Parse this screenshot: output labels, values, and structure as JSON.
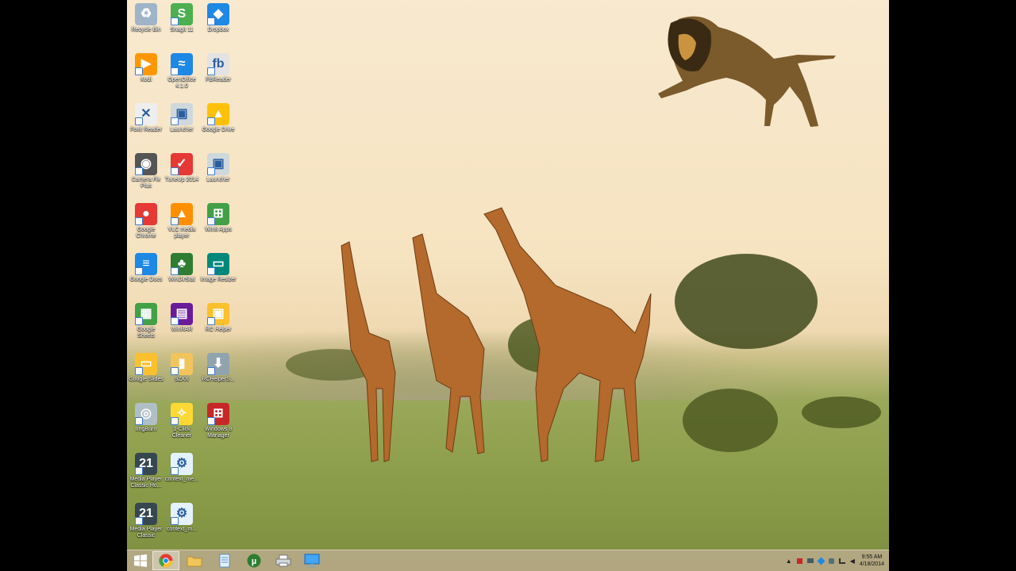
{
  "desktop": {
    "icons": [
      {
        "label": "Recycle Bin",
        "icon": "recycle-bin-icon",
        "color": "#9fb4c8"
      },
      {
        "label": "Snagit 11",
        "icon": "snagit-icon",
        "color": "#4caf50"
      },
      {
        "label": "Dropbox",
        "icon": "dropbox-icon",
        "color": "#1e88e5"
      },
      {
        "label": "Kodi",
        "icon": "media-play-icon",
        "color": "#ff9800"
      },
      {
        "label": "OpenOffice 4.1.0",
        "icon": "openoffice-icon",
        "color": "#1e88e5"
      },
      {
        "label": "FBReader",
        "icon": "fb-reader-icon",
        "color": "#e3e3e3"
      },
      {
        "label": "Foxit Reader",
        "icon": "foxit-icon",
        "color": "#eeeeee"
      },
      {
        "label": "Launcher",
        "icon": "window-icon",
        "color": "#cfd8dc"
      },
      {
        "label": "Google Drive",
        "icon": "google-drive-icon",
        "color": "#ffc107"
      },
      {
        "label": "Camera Fix Plus",
        "icon": "camera-icon",
        "color": "#555555"
      },
      {
        "label": "TuneUp 2014",
        "icon": "checkmark-icon",
        "color": "#e53935"
      },
      {
        "label": "Launcher",
        "icon": "window-icon",
        "color": "#cfd8dc"
      },
      {
        "label": "Google Chrome",
        "icon": "chrome-icon",
        "color": "#e53935"
      },
      {
        "label": "VLC media player",
        "icon": "vlc-cone-icon",
        "color": "#ff8f00"
      },
      {
        "label": "Win8 Apps",
        "icon": "windows-store-icon",
        "color": "#43a047"
      },
      {
        "label": "Google Docs",
        "icon": "google-docs-icon",
        "color": "#1e88e5"
      },
      {
        "label": "WinDirStat",
        "icon": "tree-icon",
        "color": "#2e7d32"
      },
      {
        "label": "Image Resizer",
        "icon": "picture-icon",
        "color": "#00897b"
      },
      {
        "label": "Google Sheets",
        "icon": "google-sheets-icon",
        "color": "#43a047"
      },
      {
        "label": "WinRAR",
        "icon": "winrar-icon",
        "color": "#6a1b9a"
      },
      {
        "label": "RC Helper",
        "icon": "rc-helper-icon",
        "color": "#fbc02d"
      },
      {
        "label": "Google Slides",
        "icon": "google-slides-icon",
        "color": "#fbc02d"
      },
      {
        "label": "9ZXX",
        "icon": "folder-icon",
        "color": "#f2c55c"
      },
      {
        "label": "RCHelperS...",
        "icon": "installer-icon",
        "color": "#90a4ae"
      },
      {
        "label": "ImgBurn",
        "icon": "disc-icon",
        "color": "#b0bec5"
      },
      {
        "label": "1-Click Cleaner",
        "icon": "cleaner-icon",
        "color": "#fdd835"
      },
      {
        "label": "Windows 8 Manager",
        "icon": "windows-manager-icon",
        "color": "#c62828"
      },
      {
        "label": "Media Player Classic Ho...",
        "icon": "mpc-film-icon",
        "color": "#37474f"
      },
      {
        "label": "context_me...",
        "icon": "registry-file-icon",
        "color": "#e3f2fd"
      },
      {
        "label": "Media Player Classic",
        "icon": "mpc-film-icon",
        "color": "#37474f"
      },
      {
        "label": "context_m...",
        "icon": "registry-file-icon",
        "color": "#e3f2fd"
      }
    ]
  },
  "taskbar": {
    "start_icon": "windows-start-icon",
    "pinned": [
      {
        "name": "chrome",
        "icon": "chrome-icon",
        "active": true
      },
      {
        "name": "file-explorer",
        "icon": "folder-icon",
        "active": false
      },
      {
        "name": "notepad",
        "icon": "document-icon",
        "active": false
      },
      {
        "name": "utorrent",
        "icon": "utorrent-icon",
        "active": false
      },
      {
        "name": "printer",
        "icon": "printer-icon",
        "active": false
      },
      {
        "name": "remote-desktop",
        "icon": "monitor-icon",
        "active": false
      }
    ],
    "clock": {
      "time": "9:55 AM",
      "date": "4/18/2014"
    }
  },
  "colors": {
    "taskbar": "#baaa8c",
    "accent": "#1e88e5"
  }
}
